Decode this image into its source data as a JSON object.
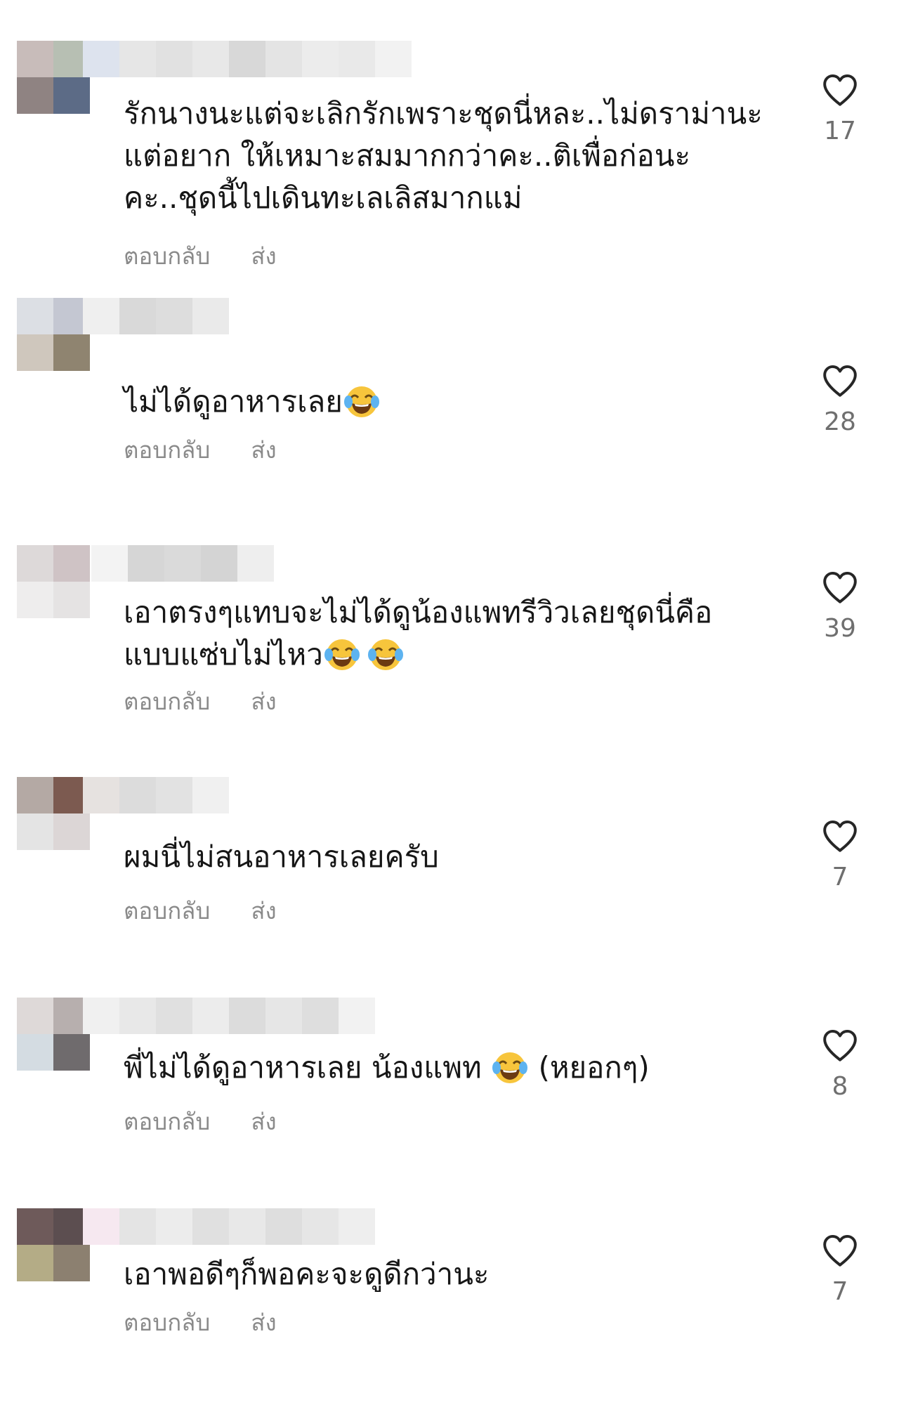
{
  "comments": [
    {
      "text": "รักนางนะแต่จะเลิกรักเพราะชุดนี่หละ..ไม่ดราม่านะ\nแต่อยาก ให้เหมาะสมมากกว่าคะ..ติเพื่อก่อนะ\nคะ..ชุดนี้ไปเดินทะเลเลิสมากแม่",
      "emoji_count": 0,
      "likes": "17",
      "reply": "ตอบกลับ",
      "send": "ส่ง"
    },
    {
      "text": "ไม่ได้ดูอาหารเลย",
      "emoji_count": 1,
      "likes": "28",
      "reply": "ตอบกลับ",
      "send": "ส่ง"
    },
    {
      "text": "เอาตรงๆแทบจะไม่ได้ดูน้องแพทรีวิวเลยชุดนี่คือ\nแบบแซ่บไม่ไหว",
      "emoji_count": 2,
      "likes": "39",
      "reply": "ตอบกลับ",
      "send": "ส่ง"
    },
    {
      "text": "ผมนี่ไม่สนอาหารเลยครับ",
      "emoji_count": 0,
      "likes": "7",
      "reply": "ตอบกลับ",
      "send": "ส่ง"
    },
    {
      "text": "พี่ไม่ได้ดูอาหารเลย น้องแพท ",
      "text_after": " (หยอกๆ)",
      "emoji_count": 1,
      "likes": "8",
      "reply": "ตอบกลับ",
      "send": "ส่ง"
    },
    {
      "text": "เอาพอดีๆก็พอคะจะดูดีกว่านะ",
      "emoji_count": 0,
      "likes": "7",
      "reply": "ตอบกลับ",
      "send": "ส่ง"
    }
  ],
  "icons": {
    "like": "heart-outline-icon",
    "emoji": "tears-of-joy-emoji-icon"
  },
  "colors": {
    "text": "#161616",
    "secondary": "#8a8a8a",
    "count": "#6f6f6f",
    "heart_stroke": "#262626"
  }
}
